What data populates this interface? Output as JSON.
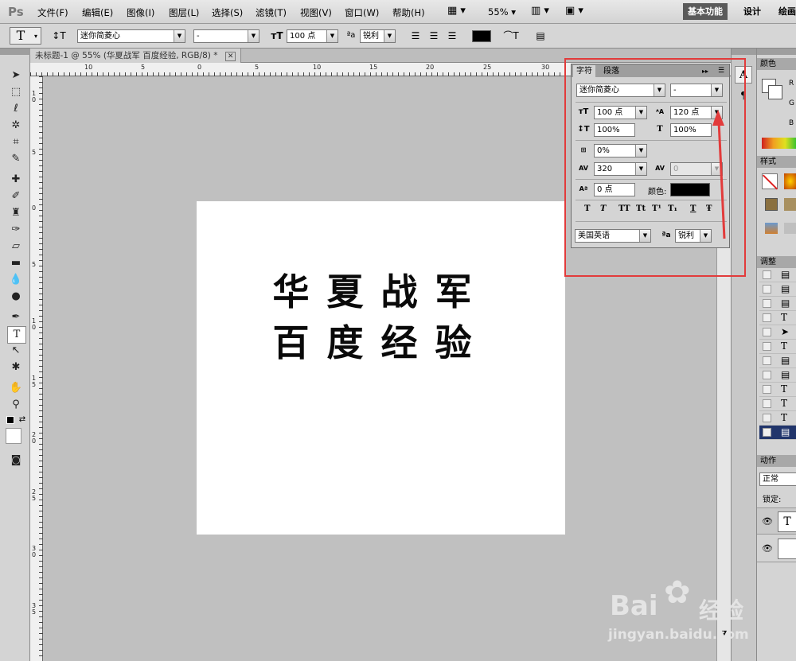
{
  "menubar": {
    "logo": "Ps",
    "menus": [
      "文件(F)",
      "编辑(E)",
      "图像(I)",
      "图层(L)",
      "选择(S)",
      "滤镜(T)",
      "视图(V)",
      "窗口(W)",
      "帮助(H)"
    ],
    "zoom": "55%",
    "workspaces": [
      "基本功能",
      "设计",
      "绘画"
    ]
  },
  "options": {
    "font_family": "迷你简菱心",
    "font_style": "-",
    "font_size": "100 点",
    "anti_alias": "锐利"
  },
  "document": {
    "tab_title": "未标题-1 @ 55% (华夏战军 百度经验, RGB/8) *",
    "text_line1": "华夏战军",
    "text_line2": "百度经验",
    "hruler_labels": [
      "10",
      "5",
      "0",
      "5",
      "10",
      "15",
      "20",
      "25",
      "30"
    ],
    "vruler_labels": [
      "1\n0",
      "5",
      "0",
      "5",
      "1\n0",
      "1\n5",
      "2\n0",
      "2\n5",
      "3\n0",
      "3\n5"
    ]
  },
  "char_panel": {
    "tabs": [
      "字符",
      "段落"
    ],
    "font_family": "迷你简菱心",
    "font_style": "-",
    "font_size": "100 点",
    "leading": "120 点",
    "vertical_scale": "100%",
    "horizontal_scale": "100%",
    "tsume": "0%",
    "tracking": "320",
    "kerning": "0",
    "baseline_shift": "0 点",
    "color_label": "颜色:",
    "color": "#000000",
    "format_buttons": [
      "T",
      "T",
      "TT",
      "Tt",
      "T¹",
      "T₁",
      "T",
      "Ŧ"
    ],
    "language": "美国英语",
    "anti_alias": "锐利"
  },
  "right_panels": {
    "color_tab": "颜色",
    "color_letters": [
      "R",
      "G",
      "B"
    ],
    "styles_tab": "样式",
    "adjust_tab": "调整",
    "actions_tab": "动作",
    "blend_mode": "正常",
    "lock_label": "锁定:"
  },
  "watermark": {
    "brand": "Bai",
    "brand2": "经验",
    "url": "jingyan.baidu.com"
  },
  "accent_color": "#e23b3b"
}
